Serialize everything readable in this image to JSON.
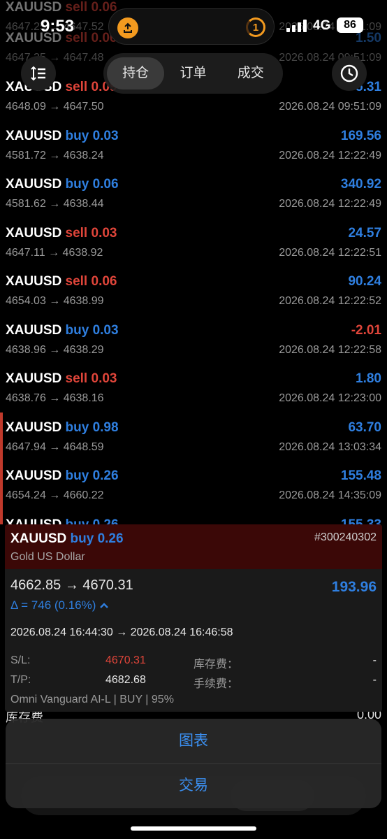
{
  "status": {
    "time": "9:53",
    "network": "4G",
    "battery": "86",
    "island_badge": "1"
  },
  "tabs": [
    {
      "label": "持仓",
      "active": true
    },
    {
      "label": "订单",
      "active": false
    },
    {
      "label": "成交",
      "active": false
    }
  ],
  "rows": [
    {
      "symbol": "XAUUSD",
      "side": "sell",
      "volume": "0.06",
      "price": "4647.25 → 4647.52",
      "time": "2026.08.24 09:51:09",
      "profit": "",
      "faded": true
    },
    {
      "symbol": "XAUUSD",
      "side": "sell",
      "volume": "0.06",
      "price": "4647.25 → 4647.48",
      "time": "2026.08.24 09:51:09",
      "profit": "1.50",
      "faded": true
    },
    {
      "symbol": "XAUUSD",
      "side": "sell",
      "volume": "0.09",
      "price": "4648.09 → 4647.50",
      "time": "2026.08.24 09:51:09",
      "profit": "5.31",
      "faded": false
    },
    {
      "symbol": "XAUUSD",
      "side": "buy",
      "volume": "0.03",
      "price": "4581.72 → 4638.24",
      "time": "2026.08.24 12:22:49",
      "profit": "169.56",
      "faded": false
    },
    {
      "symbol": "XAUUSD",
      "side": "buy",
      "volume": "0.06",
      "price": "4581.62 → 4638.44",
      "time": "2026.08.24 12:22:49",
      "profit": "340.92",
      "faded": false
    },
    {
      "symbol": "XAUUSD",
      "side": "sell",
      "volume": "0.03",
      "price": "4647.11 → 4638.92",
      "time": "2026.08.24 12:22:51",
      "profit": "24.57",
      "faded": false
    },
    {
      "symbol": "XAUUSD",
      "side": "sell",
      "volume": "0.06",
      "price": "4654.03 → 4638.99",
      "time": "2026.08.24 12:22:52",
      "profit": "90.24",
      "faded": false
    },
    {
      "symbol": "XAUUSD",
      "side": "buy",
      "volume": "0.03",
      "price": "4638.96 → 4638.29",
      "time": "2026.08.24 12:22:58",
      "profit": "-2.01",
      "faded": false
    },
    {
      "symbol": "XAUUSD",
      "side": "sell",
      "volume": "0.03",
      "price": "4638.76 → 4638.16",
      "time": "2026.08.24 12:23:00",
      "profit": "1.80",
      "faded": false
    },
    {
      "symbol": "XAUUSD",
      "side": "buy",
      "volume": "0.98",
      "price": "4647.94 → 4648.59",
      "time": "2026.08.24 13:03:34",
      "profit": "63.70",
      "faded": false
    },
    {
      "symbol": "XAUUSD",
      "side": "buy",
      "volume": "0.26",
      "price": "4654.24 → 4660.22",
      "time": "2026.08.24 14:35:09",
      "profit": "155.48",
      "faded": false
    },
    {
      "symbol": "XAUUSD",
      "side": "buy",
      "volume": "0.26",
      "price": "",
      "time": "",
      "profit": "155.33",
      "faded": false
    }
  ],
  "detail": {
    "symbol": "XAUUSD",
    "side": "buy",
    "volume": "0.26",
    "ticket": "#300240302",
    "description": "Gold US Dollar",
    "price": "4662.85 → 4670.31",
    "profit": "193.96",
    "delta": "Δ = 746 (0.16%)",
    "times": "2026.08.24 16:44:30 → 2026.08.24 16:46:58",
    "sl_label": "S/L:",
    "sl_value": "4670.31",
    "tp_label": "T/P:",
    "tp_value": "4682.68",
    "swap_label": "库存费：",
    "swap_value": "-",
    "fee_label": "手续费：",
    "fee_value": "-",
    "strategy": "Omni Vanguard AI-L | BUY | 95%"
  },
  "behind": {
    "label": "库存费",
    "value": "0.00"
  },
  "sheet": {
    "chart": "图表",
    "trade": "交易"
  },
  "colors": {
    "buy": "#2f7fe0",
    "sell": "#e0453a",
    "header_bg": "#3b0807"
  }
}
